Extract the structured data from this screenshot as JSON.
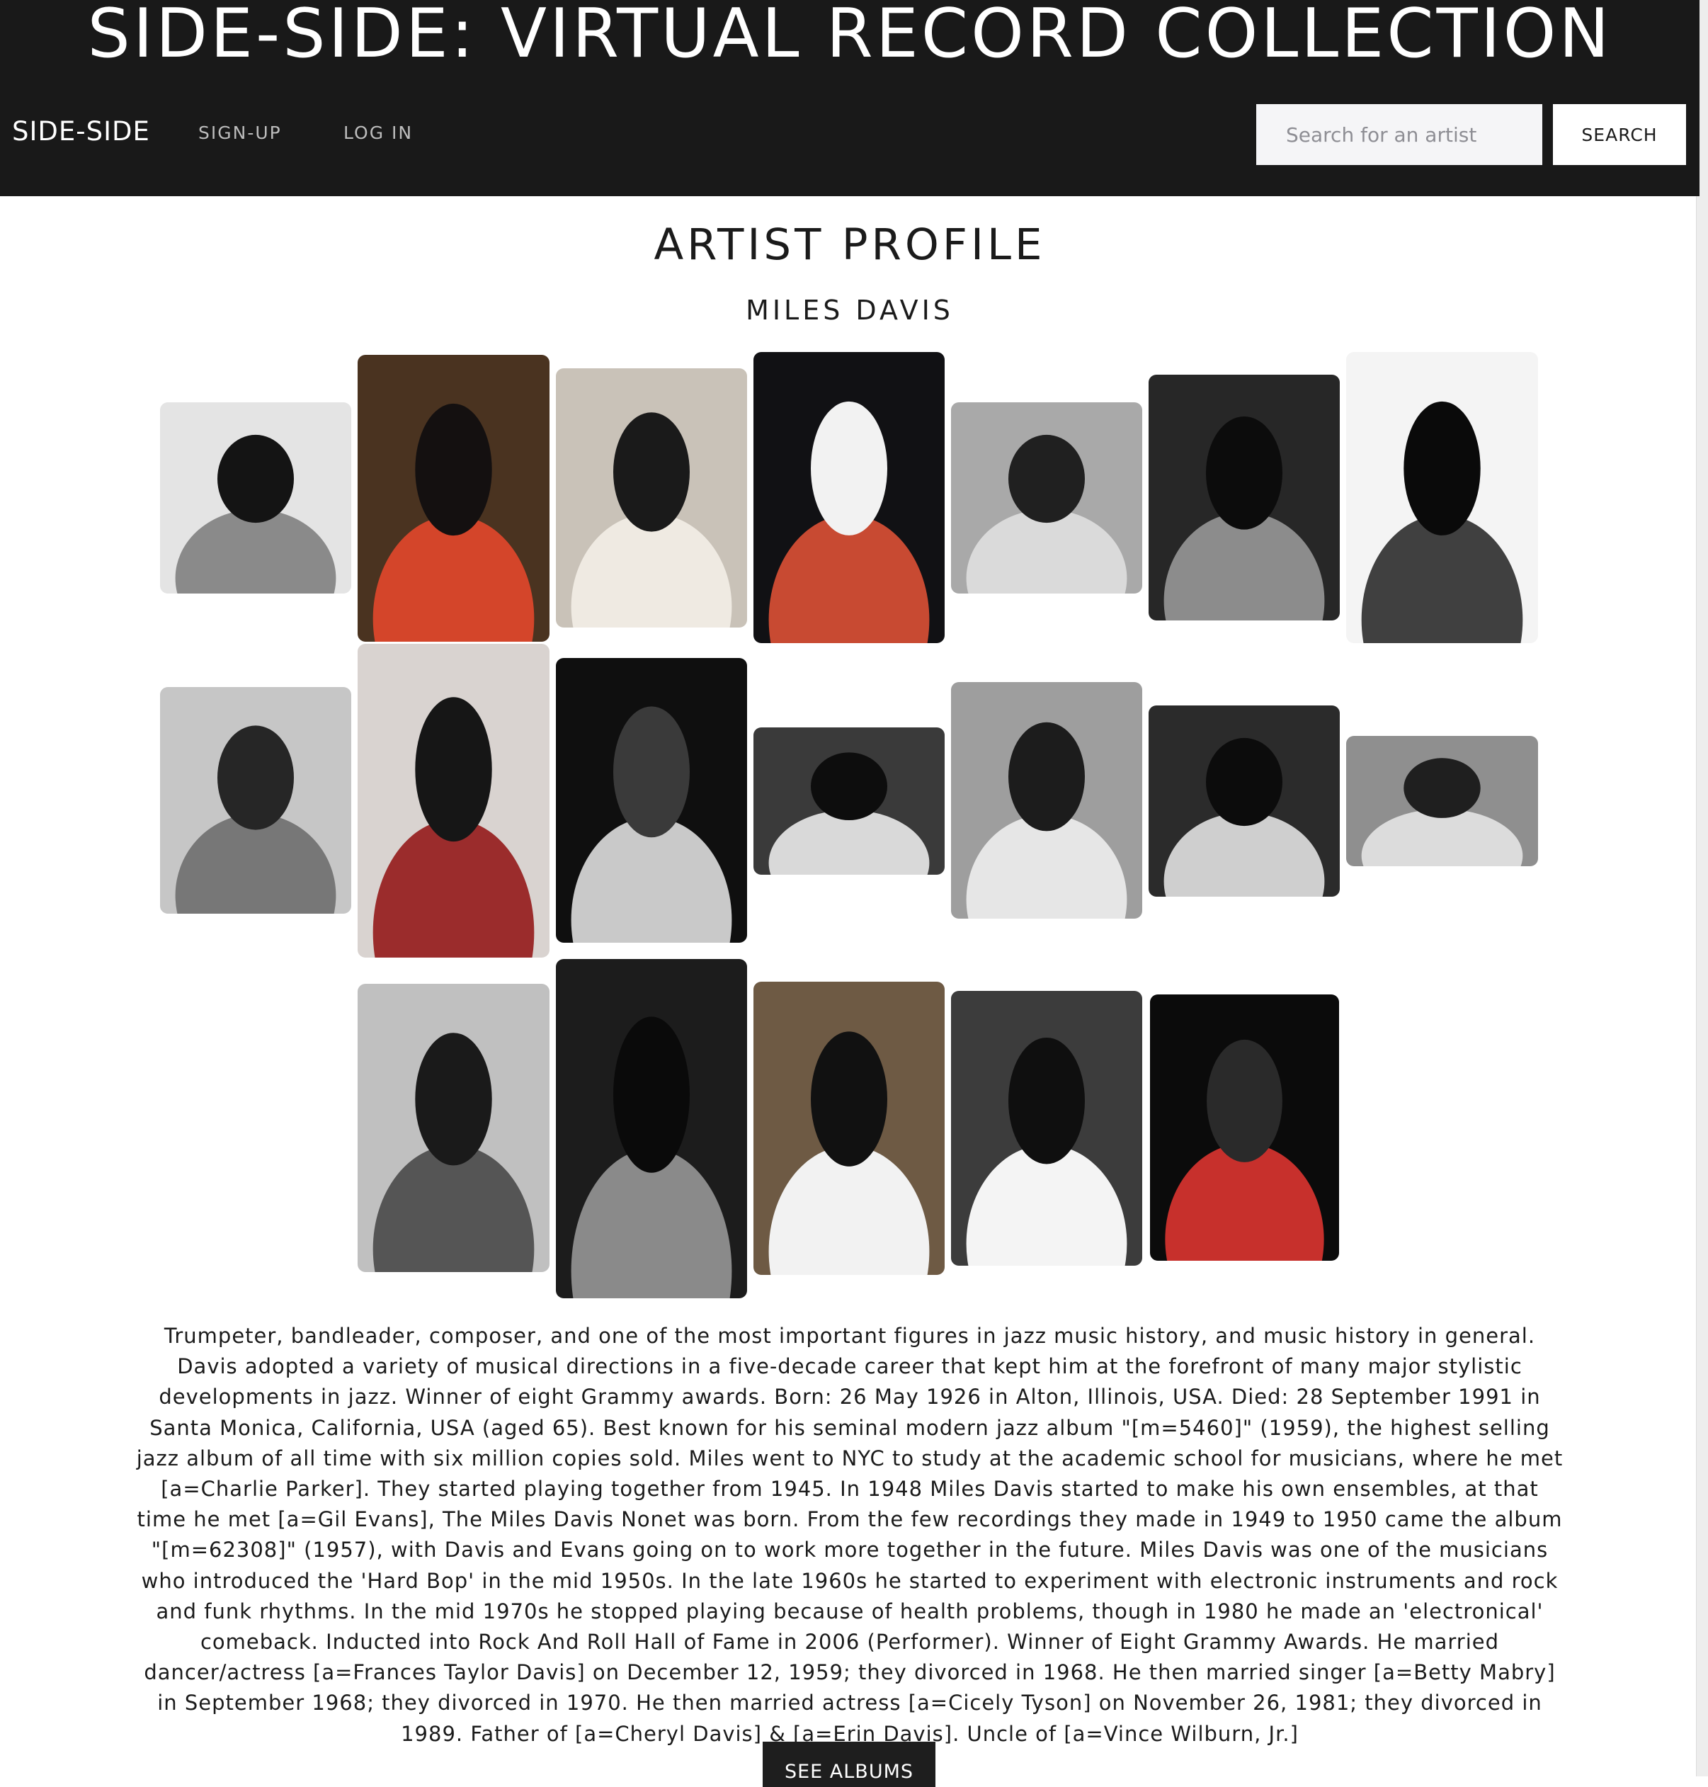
{
  "header": {
    "site_title": "SIDE-SIDE: VIRTUAL RECORD COLLECTION",
    "brand": "SIDE-SIDE",
    "nav": {
      "signup": "SIGN-UP",
      "login": "LOG IN"
    },
    "search": {
      "placeholder": "Search for an artist",
      "value": "",
      "button_label": "SEARCH"
    }
  },
  "profile": {
    "heading": "ARTIST PROFILE",
    "artist_name": "MILES DAVIS",
    "bio": "Trumpeter, bandleader, composer, and one of the most important figures in jazz music history, and music history in general. Davis adopted a variety of musical directions in a five-decade career that kept him at the forefront of many major stylistic developments in jazz. Winner of eight Grammy awards. Born: 26 May 1926 in Alton, Illinois, USA. Died: 28 September 1991 in Santa Monica, California, USA (aged 65). Best known for his seminal modern jazz album \"[m=5460]\" (1959), the highest selling jazz album of all time with six million copies sold. Miles went to NYC to study at the academic school for musicians, where he met [a=Charlie Parker]. They started playing together from 1945. In 1948 Miles Davis started to make his own ensembles, at that time he met [a=Gil Evans], The Miles Davis Nonet was born. From the few recordings they made in 1949 to 1950 came the album \"[m=62308]\" (1957), with Davis and Evans going on to work more together in the future. Miles Davis was one of the musicians who introduced the 'Hard Bop' in the mid 1950s. In the late 1960s he started to experiment with electronic instruments and rock and funk rhythms. In the mid 1970s he stopped playing because of health problems, though in 1980 he made an 'electronical' comeback. Inducted into Rock And Roll Hall of Fame in 2006 (Performer). Winner of Eight Grammy Awards. He married dancer/actress [a=Frances Taylor Davis] on December 12, 1959; they divorced in 1968. He then married singer [a=Betty Mabry] in September 1968; they divorced in 1970. He then married actress [a=Cicely Tyson] on November 26, 1981; they divorced in 1989. Father of [a=Cheryl Davis] & [a=Erin Davis]. Uncle of [a=Vince Wilburn, Jr.]",
    "see_albums_label": "SEE ALBUMS"
  },
  "gallery": {
    "photos": [
      {
        "bg": "#e4e4e4",
        "fg": "#141414",
        "accent": "#8a8a8a"
      },
      {
        "bg": "#4a3320",
        "fg": "#141010",
        "accent": "#d4452a"
      },
      {
        "bg": "#c9c2b8",
        "fg": "#1a1a1a",
        "accent": "#efeae2"
      },
      {
        "bg": "#111114",
        "fg": "#f2f2f2",
        "accent": "#c84a32"
      },
      {
        "bg": "#a9a9a9",
        "fg": "#202020",
        "accent": "#dadada"
      },
      {
        "bg": "#272727",
        "fg": "#0c0c0c",
        "accent": "#8c8c8c"
      },
      {
        "bg": "#f4f4f4",
        "fg": "#0a0a0a",
        "accent": "#404040"
      },
      {
        "bg": "#c6c6c6",
        "fg": "#262626",
        "accent": "#777777"
      },
      {
        "bg": "#d9d3d0",
        "fg": "#161616",
        "accent": "#9b2c2c"
      },
      {
        "bg": "#0f0f0f",
        "fg": "#3a3a3a",
        "accent": "#c9c9c9"
      },
      {
        "bg": "#3a3a3a",
        "fg": "#0d0d0d",
        "accent": "#d9d9d9"
      },
      {
        "bg": "#9e9e9e",
        "fg": "#1c1c1c",
        "accent": "#e6e6e6"
      },
      {
        "bg": "#2b2b2b",
        "fg": "#0c0c0c",
        "accent": "#cfcfcf"
      },
      {
        "bg": "#8f8f8f",
        "fg": "#1f1f1f",
        "accent": "#dcdcdc"
      },
      {
        "bg": "#c0c0c0",
        "fg": "#1a1a1a",
        "accent": "#555555"
      },
      {
        "bg": "#1c1c1c",
        "fg": "#0a0a0a",
        "accent": "#8a8a8a"
      },
      {
        "bg": "#6e5a44",
        "fg": "#111111",
        "accent": "#f2f2f2"
      },
      {
        "bg": "#3c3c3c",
        "fg": "#0f0f0f",
        "accent": "#f4f4f4"
      },
      {
        "bg": "#0b0b0b",
        "fg": "#2a2a2a",
        "accent": "#c7302c"
      }
    ]
  }
}
